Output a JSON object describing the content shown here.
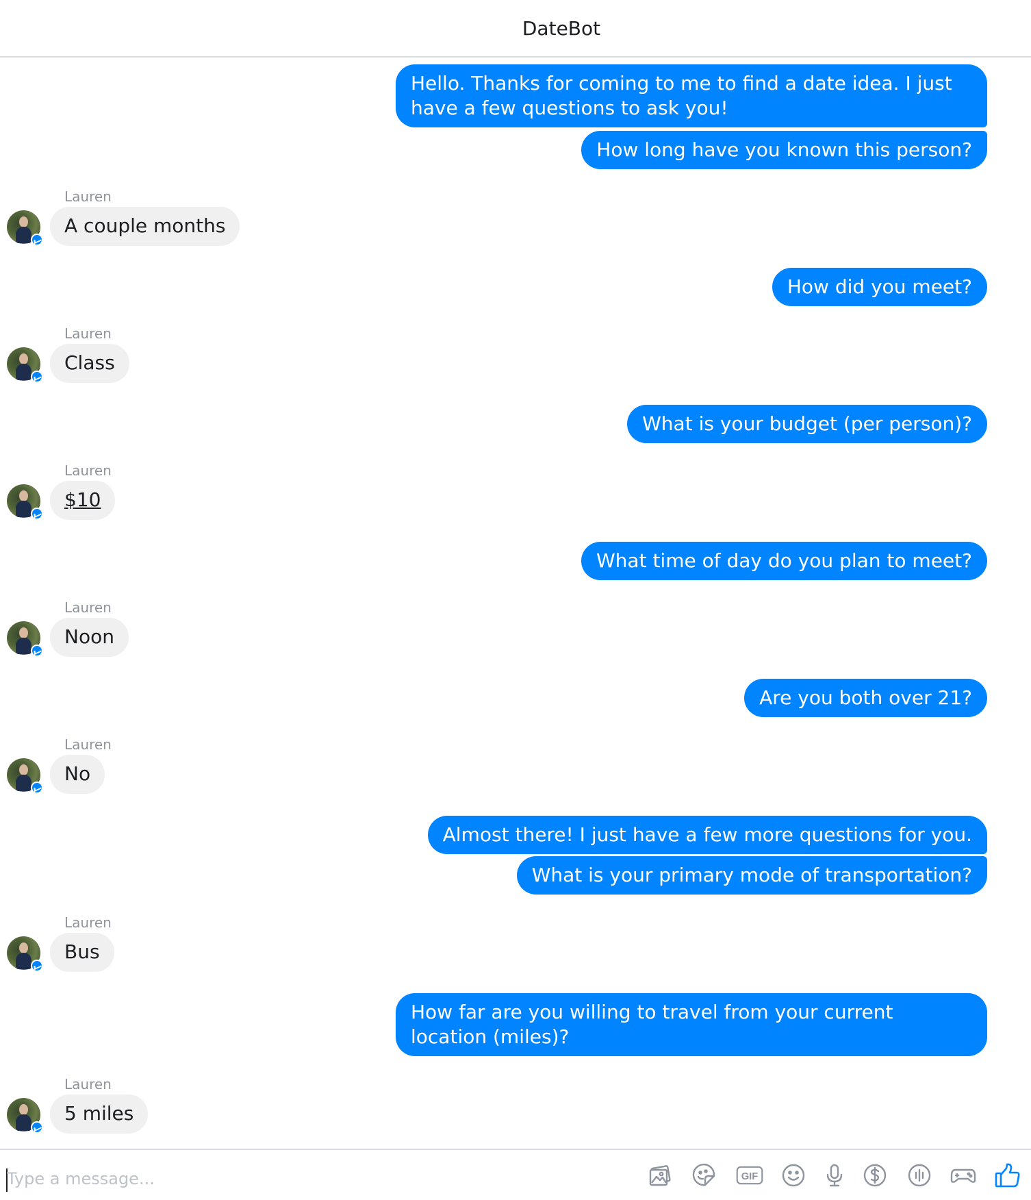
{
  "header": {
    "title": "DateBot"
  },
  "messages": [
    {
      "text": "Hello. Thanks for coming to me to find a date idea. I just have a few questions to ask you!"
    },
    {
      "text": "How long have you known this person?"
    },
    {
      "sender": "Lauren",
      "text": "A couple months"
    },
    {
      "text": "How did you meet?"
    },
    {
      "sender": "Lauren",
      "text": "Class"
    },
    {
      "text": "What is your budget (per person)?"
    },
    {
      "sender": "Lauren",
      "text": "$10"
    },
    {
      "text": "What time of day do you plan to meet?"
    },
    {
      "sender": "Lauren",
      "text": "Noon"
    },
    {
      "text": "Are you both over 21?"
    },
    {
      "sender": "Lauren",
      "text": "No"
    },
    {
      "text": "Almost there! I just have a few more questions for you."
    },
    {
      "text": "What is your primary mode of transportation?"
    },
    {
      "sender": "Lauren",
      "text": "Bus"
    },
    {
      "text": "How far are you willing to travel from your current location (miles)?"
    },
    {
      "sender": "Lauren",
      "text": "5 miles"
    }
  ],
  "composer": {
    "placeholder": "Type a message...",
    "tools": [
      "image-icon",
      "sticker-icon",
      "gif-icon",
      "emoji-icon",
      "microphone-icon",
      "payment-icon",
      "voice-clip-icon",
      "game-icon",
      "thumbs-up-icon"
    ],
    "gif_label": "GIF"
  },
  "colors": {
    "outgoing_bubble": "#0084ff",
    "incoming_bubble": "#f1f0f0",
    "tool_icon": "#8d949e",
    "like_icon": "#0084ff"
  }
}
